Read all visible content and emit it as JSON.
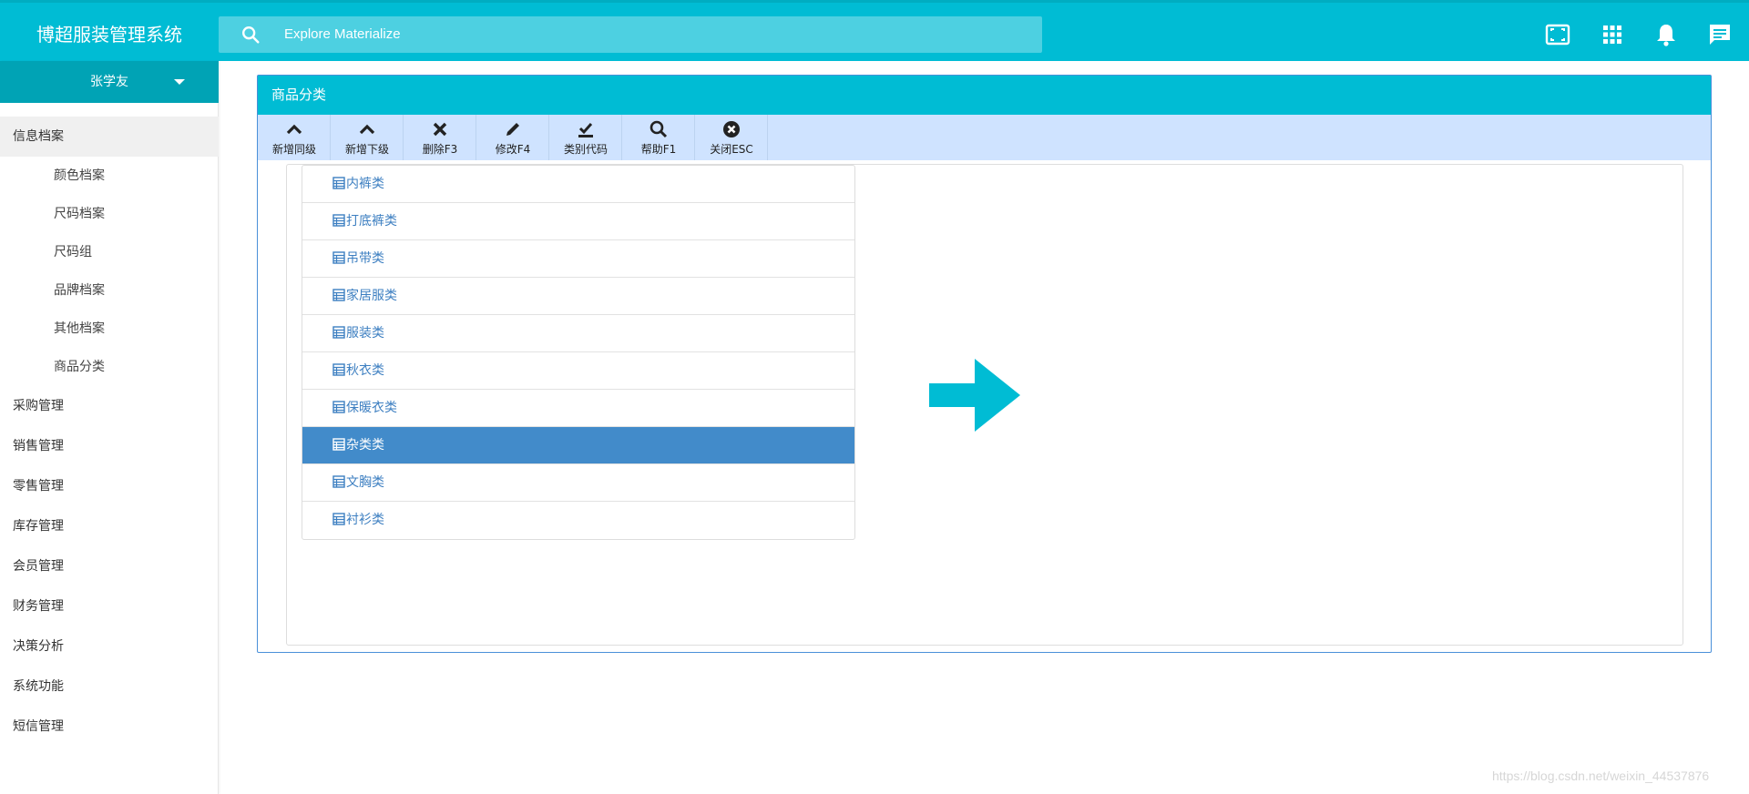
{
  "app": {
    "title": "博超服装管理系统"
  },
  "search": {
    "placeholder": "Explore Materialize"
  },
  "header_icons": [
    "fullscreen-icon",
    "apps-grid-icon",
    "notification-bell-icon",
    "chat-message-icon"
  ],
  "user": {
    "name": "张学友"
  },
  "sidebar": {
    "items": [
      {
        "label": "信息档案",
        "active": true,
        "children": [
          "颜色档案",
          "尺码档案",
          "尺码组",
          "品牌档案",
          "其他档案",
          "商品分类"
        ]
      },
      {
        "label": "采购管理"
      },
      {
        "label": "销售管理"
      },
      {
        "label": "零售管理"
      },
      {
        "label": "库存管理"
      },
      {
        "label": "会员管理"
      },
      {
        "label": "财务管理"
      },
      {
        "label": "决策分析"
      },
      {
        "label": "系统功能"
      },
      {
        "label": "短信管理"
      }
    ]
  },
  "panel": {
    "title": "商品分类"
  },
  "toolbar": [
    {
      "label": "新增同级",
      "icon": "chevron-up-icon"
    },
    {
      "label": "新增下级",
      "icon": "chevron-up-icon"
    },
    {
      "label": "删除F3",
      "icon": "close-x-icon"
    },
    {
      "label": "修改F4",
      "icon": "pencil-icon"
    },
    {
      "label": "类别代码",
      "icon": "check-underline-icon"
    },
    {
      "label": "帮助F1",
      "icon": "search-icon"
    },
    {
      "label": "关闭ESC",
      "icon": "close-circle-icon"
    }
  ],
  "categories": [
    {
      "label": "内裤类"
    },
    {
      "label": "打底裤类"
    },
    {
      "label": "吊带类"
    },
    {
      "label": "家居服类"
    },
    {
      "label": "服装类"
    },
    {
      "label": "秋衣类"
    },
    {
      "label": "保暖衣类"
    },
    {
      "label": "杂类类",
      "selected": true
    },
    {
      "label": "文胸类"
    },
    {
      "label": "衬衫类"
    }
  ],
  "colors": {
    "accent": "#00bcd4",
    "selected": "#428bca",
    "toolbar": "#cfe3ff",
    "link": "#3d7fc1"
  },
  "watermark": "https://blog.csdn.net/weixin_44537876"
}
